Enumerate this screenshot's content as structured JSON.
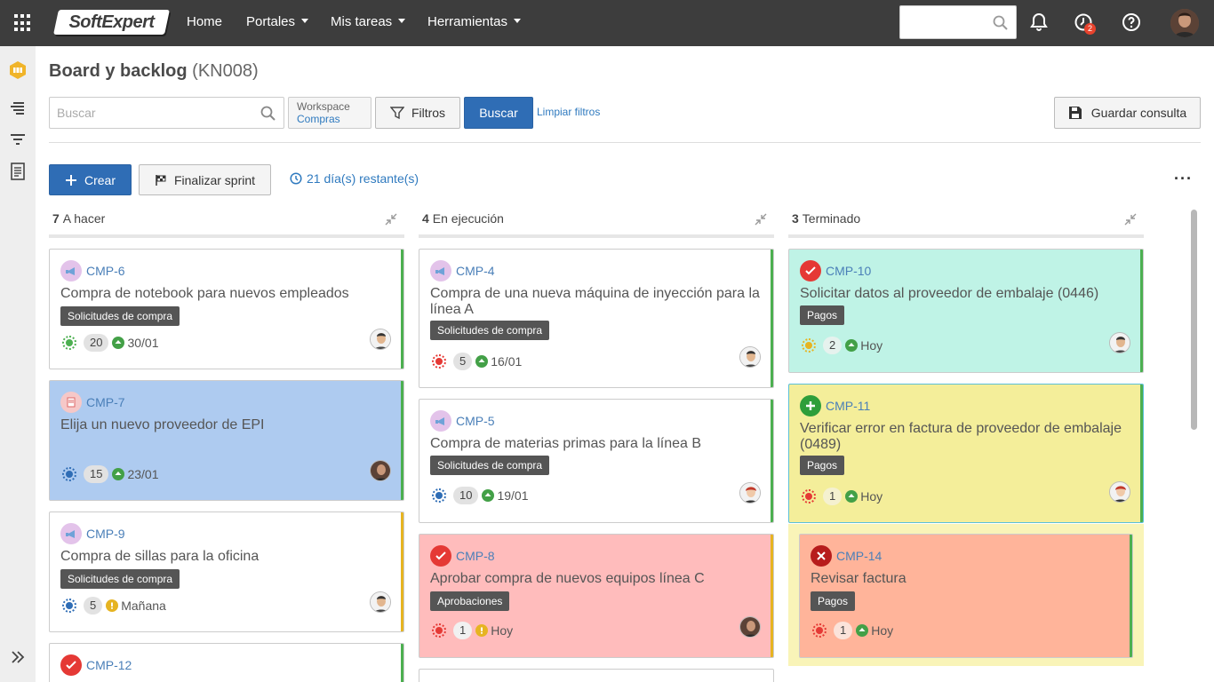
{
  "header": {
    "logo": "SoftExpert",
    "nav": [
      "Home",
      "Portales",
      "Mis tareas",
      "Herramientas"
    ],
    "notifications_count": "2"
  },
  "page": {
    "title": "Board y backlog",
    "code": "(KN008)"
  },
  "toolbar": {
    "search_placeholder": "Buscar",
    "workspace_label": "Workspace",
    "workspace_value": "Compras",
    "filters_label": "Filtros",
    "search_button": "Buscar",
    "clear_filters": "Limpiar filtros",
    "save_query": "Guardar consulta"
  },
  "actions": {
    "create": "Crear",
    "finish_sprint": "Finalizar sprint",
    "days_remaining": "21 día(s) restante(s)"
  },
  "columns": [
    {
      "count": "7",
      "label": "A hacer"
    },
    {
      "count": "4",
      "label": "En ejecución"
    },
    {
      "count": "3",
      "label": "Terminado"
    }
  ],
  "cards": [
    {
      "id": "CMP-6",
      "title": "Compra de notebook para nuevos empleados",
      "tag": "Solicitudes de compra",
      "points": "20",
      "date": "30/01"
    },
    {
      "id": "CMP-7",
      "title": "Elija un nuevo proveedor de EPI",
      "tag": "",
      "points": "15",
      "date": "23/01"
    },
    {
      "id": "CMP-9",
      "title": "Compra de sillas para la oficina",
      "tag": "Solicitudes de compra",
      "points": "5",
      "date": "Mañana"
    },
    {
      "id": "CMP-12",
      "title": "",
      "tag": "",
      "points": "",
      "date": ""
    },
    {
      "id": "CMP-4",
      "title": "Compra de una nueva máquina de inyección para la línea A",
      "tag": "Solicitudes de compra",
      "points": "5",
      "date": "16/01"
    },
    {
      "id": "CMP-5",
      "title": "Compra de materias primas para la línea B",
      "tag": "Solicitudes de compra",
      "points": "10",
      "date": "19/01"
    },
    {
      "id": "CMP-8",
      "title": "Aprobar compra de nuevos equipos línea C",
      "tag": "Aprobaciones",
      "points": "1",
      "date": "Hoy"
    },
    {
      "id": "CMP-10",
      "title": "Solicitar datos al proveedor de embalaje (0446)",
      "tag": "Pagos",
      "points": "2",
      "date": "Hoy"
    },
    {
      "id": "CMP-11",
      "title": "Verificar error en factura de proveedor de embalaje (0489)",
      "tag": "Pagos",
      "points": "1",
      "date": "Hoy"
    },
    {
      "id": "CMP-14",
      "title": "Revisar factura",
      "tag": "Pagos",
      "points": "1",
      "date": "Hoy"
    }
  ],
  "colors": {
    "topbar": "#3d3d3d",
    "primary": "#2f6db5",
    "link": "#2f7abf",
    "card_blue": "#aecbf0",
    "card_teal": "#bff3e6",
    "card_yellow": "#f4ee9a",
    "card_red": "#ffbcbc",
    "card_orange": "#ffb49a"
  }
}
